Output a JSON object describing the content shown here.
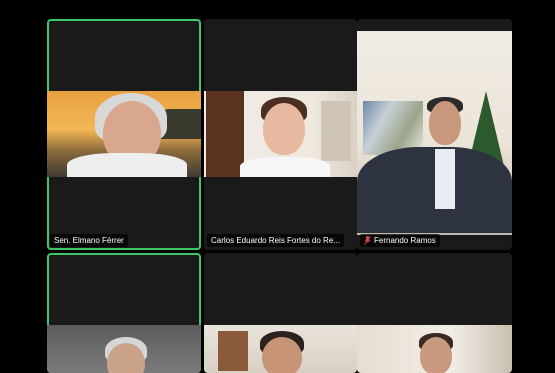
{
  "participants": [
    {
      "name": "Sen. Elmano Férrer",
      "muted": false,
      "active": true
    },
    {
      "name": "Carlos Eduardo Reis Fortes do Re...",
      "muted": false,
      "active": false
    },
    {
      "name": "Fernando Ramos",
      "muted": true,
      "active": false
    }
  ],
  "colors": {
    "active_border": "#3cc76a",
    "mute": "#e0454b",
    "tile_bg": "#1a1a1a"
  }
}
